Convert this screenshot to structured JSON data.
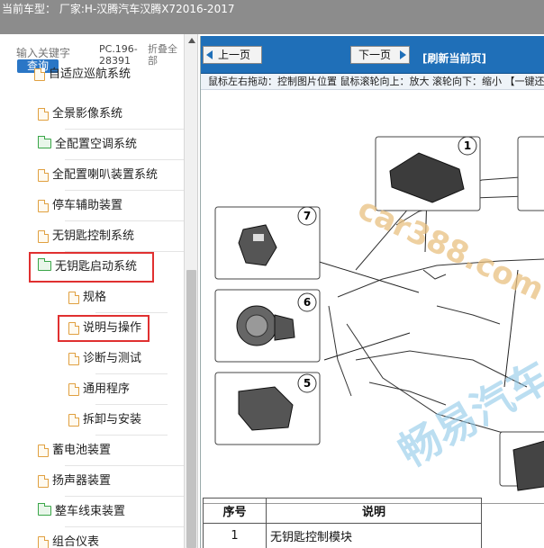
{
  "topbar": {
    "title": "当前车型：  厂家:H-汉腾汽车汉腾X72016-2017"
  },
  "search": {
    "placeholder": "输入关键字",
    "button": "查询",
    "code": "PC.196-28391",
    "collapse": "折叠全部"
  },
  "tree": {
    "items": [
      {
        "label": "自适应巡航系统",
        "icon": "doc-icon"
      },
      {
        "label": "全景影像系统",
        "icon": "doc-icon"
      },
      {
        "label": "全配置空调系统",
        "icon": "folder-icon"
      },
      {
        "label": "全配置喇叭装置系统",
        "icon": "doc-icon"
      },
      {
        "label": "停车辅助装置",
        "icon": "doc-icon"
      },
      {
        "label": "无钥匙控制系统",
        "icon": "doc-icon"
      },
      {
        "label": "无钥匙启动系统",
        "icon": "folder-open-icon"
      },
      {
        "label": "规格",
        "icon": "doc-icon"
      },
      {
        "label": "说明与操作",
        "icon": "doc-icon"
      },
      {
        "label": "诊断与测试",
        "icon": "doc-icon"
      },
      {
        "label": "通用程序",
        "icon": "doc-icon"
      },
      {
        "label": "拆卸与安装",
        "icon": "doc-icon"
      },
      {
        "label": "蓄电池装置",
        "icon": "doc-icon"
      },
      {
        "label": "扬声器装置",
        "icon": "doc-icon"
      },
      {
        "label": "整车线束装置",
        "icon": "folder-icon"
      },
      {
        "label": "组合仪表",
        "icon": "doc-icon"
      }
    ]
  },
  "toolbar": {
    "prev": "上一页",
    "next": "下一页",
    "refresh": "[刷新当前页]"
  },
  "hint": "鼠标左右拖动：控制图片位置  鼠标滚轮向上：放大  滚轮向下：缩小  【一键还原】",
  "diagram": {
    "callouts": [
      "1",
      "7",
      "6",
      "5"
    ],
    "watermark1": "car388.com",
    "watermark2": "畅易汽车"
  },
  "table": {
    "headers": [
      "序号",
      "说明"
    ],
    "rows": [
      {
        "no": "1",
        "desc": "无钥匙控制模块"
      }
    ]
  },
  "colors": {
    "toolbar": "#1f6fb8",
    "highlight": "#e03030",
    "topbar": "#8c8c8c",
    "query": "#2a76c6"
  }
}
